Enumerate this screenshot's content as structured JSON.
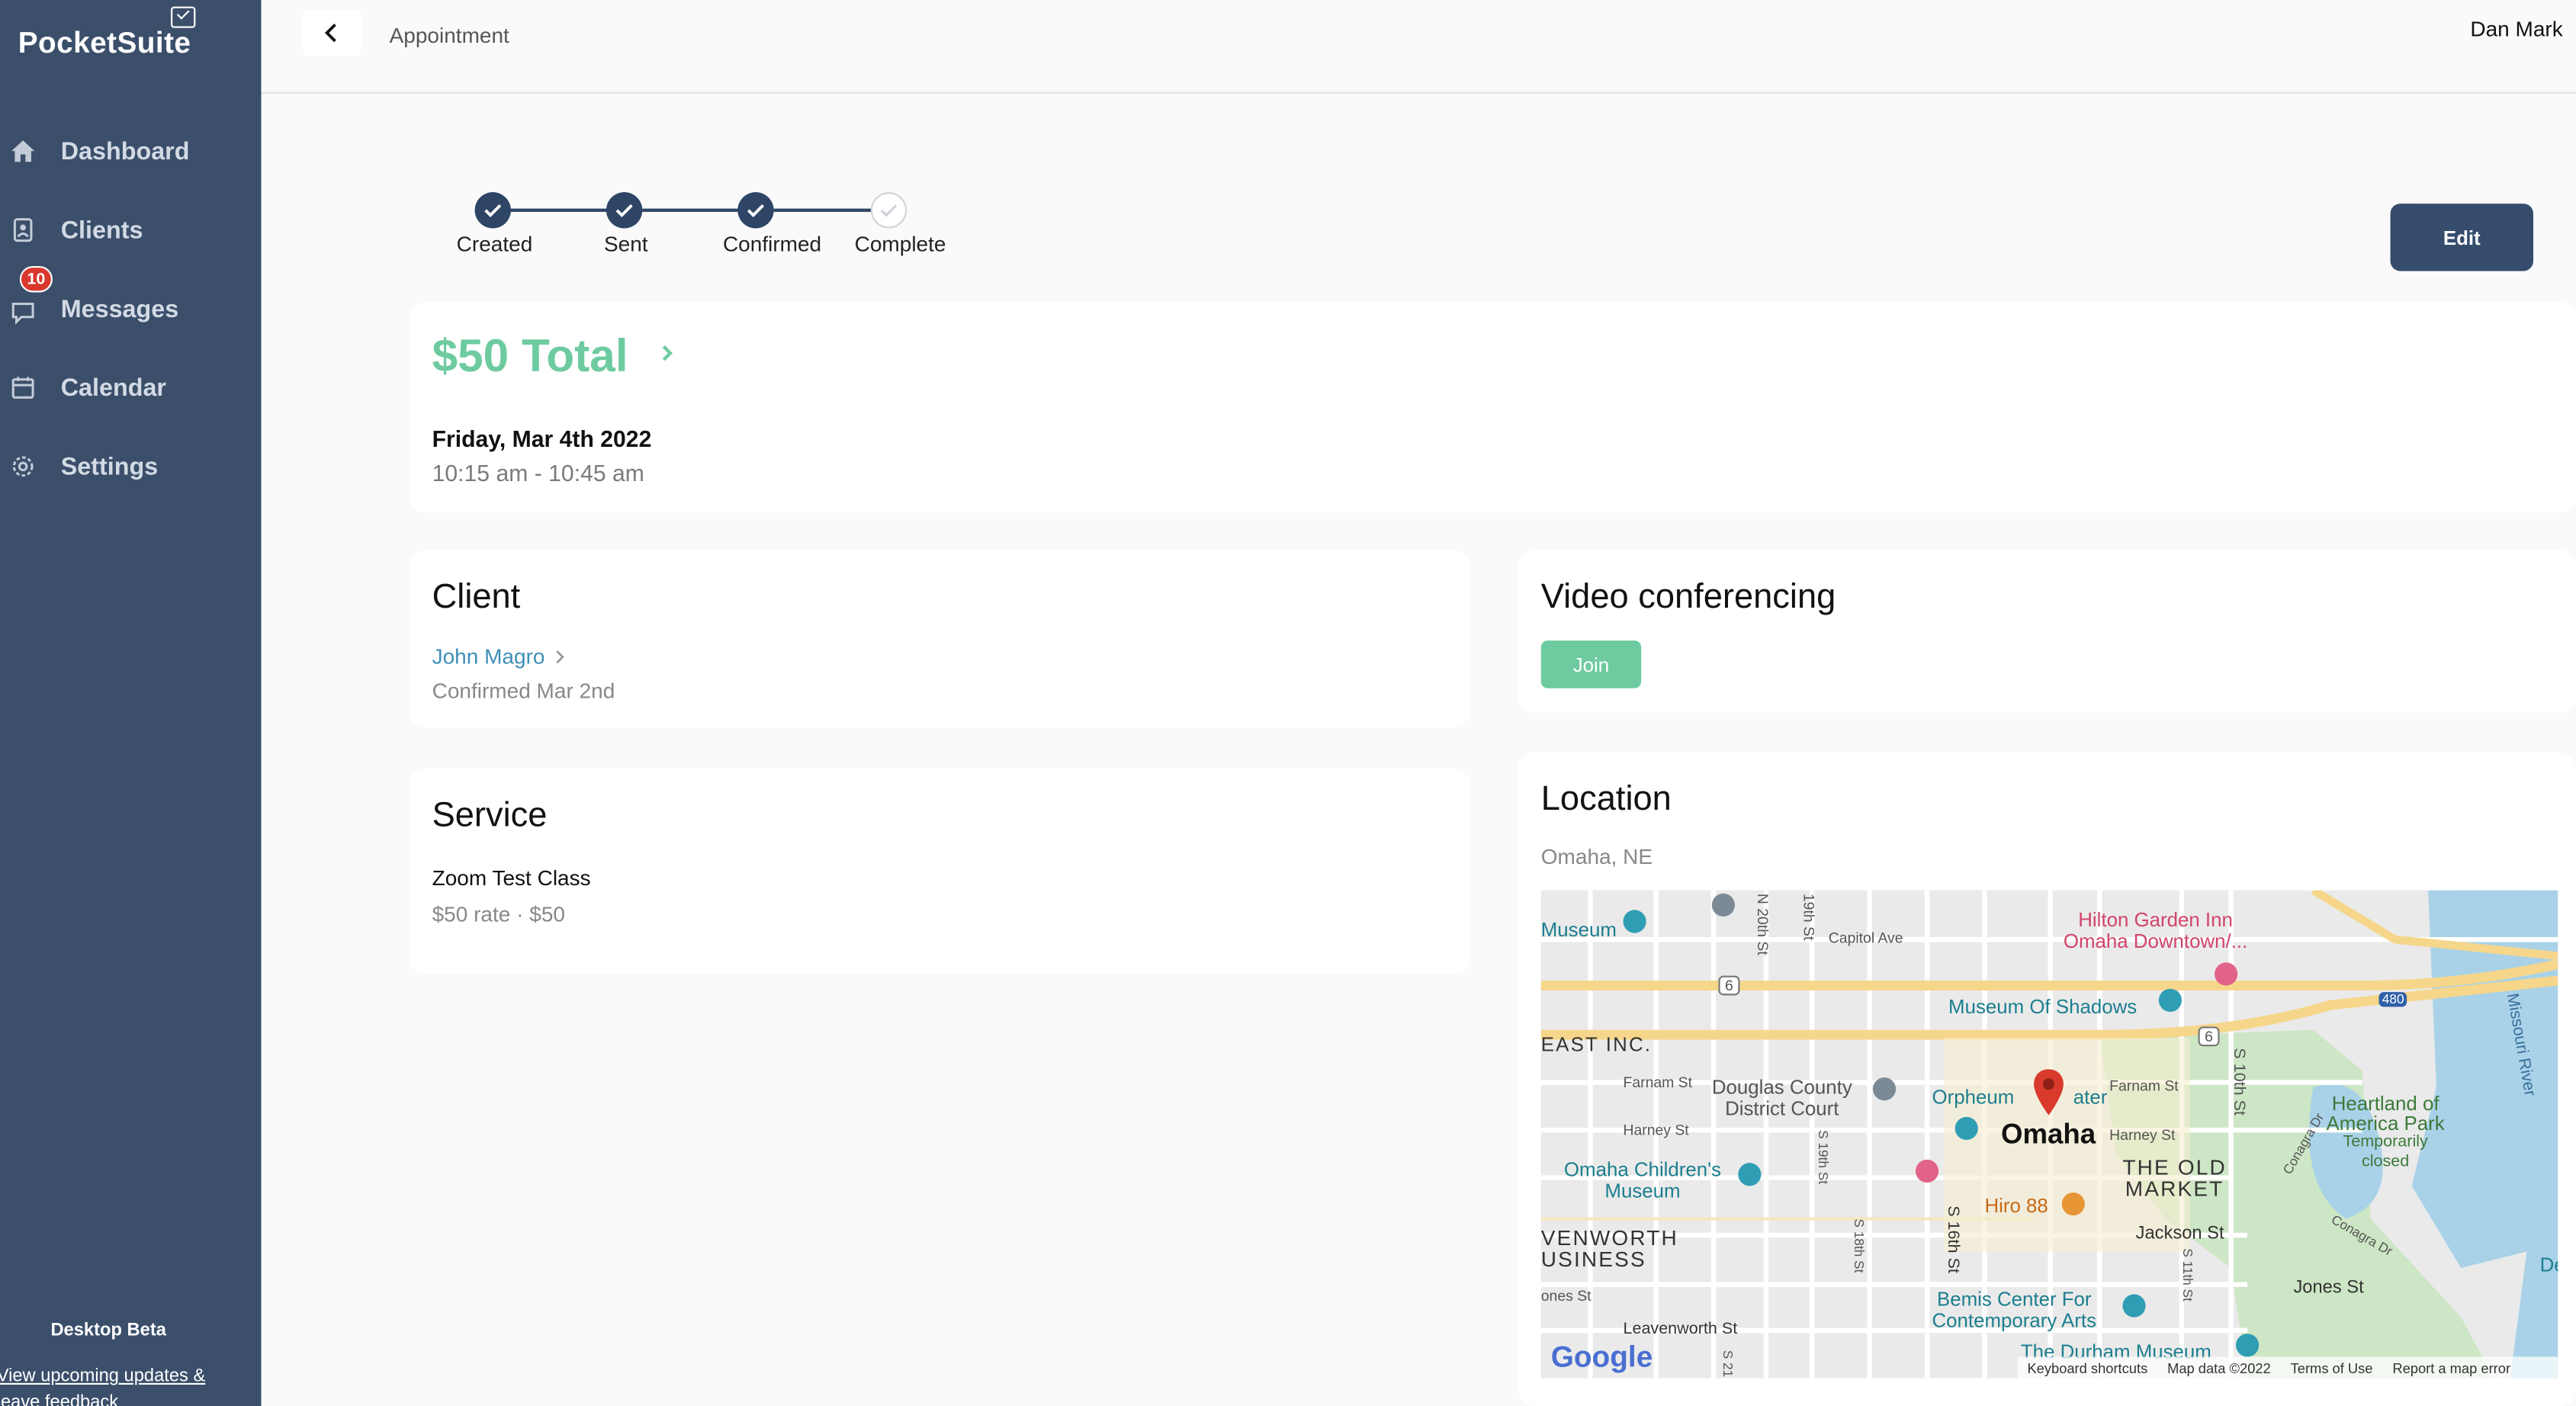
{
  "app": {
    "name": "PocketSuite"
  },
  "sidebar": {
    "items": [
      {
        "label": "Dashboard",
        "icon": "home-icon"
      },
      {
        "label": "Clients",
        "icon": "id-card-icon"
      },
      {
        "label": "Messages",
        "icon": "chat-icon",
        "badge": "10"
      },
      {
        "label": "Calendar",
        "icon": "calendar-icon"
      },
      {
        "label": "Settings",
        "icon": "gear-icon"
      }
    ],
    "beta_label": "Desktop Beta",
    "feedback_line1": "View upcoming updates &",
    "feedback_line2": "leave feedback"
  },
  "header": {
    "breadcrumb": "Appointment",
    "user_name": "Dan Mark"
  },
  "stepper": {
    "steps": [
      {
        "label": "Created",
        "done": true
      },
      {
        "label": "Sent",
        "done": true
      },
      {
        "label": "Confirmed",
        "done": true
      },
      {
        "label": "Complete",
        "done": false
      }
    ]
  },
  "actions": {
    "edit_label": "Edit"
  },
  "summary": {
    "total": "$50 Total",
    "date": "Friday, Mar 4th 2022",
    "time": "10:15 am - 10:45 am"
  },
  "client": {
    "title": "Client",
    "name": "John Magro",
    "status": "Confirmed Mar 2nd"
  },
  "service": {
    "title": "Service",
    "name": "Zoom Test Class",
    "rate": "$50 rate · $50"
  },
  "video": {
    "title": "Video conferencing",
    "join_label": "Join"
  },
  "location": {
    "title": "Location",
    "address": "Omaha, NE",
    "map": {
      "city": "Omaha",
      "places": {
        "museum_left": "Museum",
        "hilton_1": "Hilton Garden Inn",
        "hilton_2": "Omaha Downtown/...",
        "shadows": "Museum Of Shadows",
        "east_inc": "EAST INC.",
        "douglas_1": "Douglas County",
        "douglas_2": "District Court",
        "orpheum_a": "Orpheum",
        "orpheum_b": "ater",
        "heartland_1": "Heartland of",
        "heartland_2": "America Park",
        "heartland_3": "Temporarily",
        "heartland_4": "closed",
        "childrens_1": "Omaha Children's",
        "childrens_2": "Museum",
        "old_market_1": "THE OLD",
        "old_market_2": "MARKET",
        "hiro": "Hiro 88",
        "leavenworth_1": "VENWORTH",
        "leavenworth_2": "USINESS",
        "bemis_1": "Bemis Center For",
        "bemis_2": "Contemporary Arts",
        "durham": "The Durham Museum",
        "de": "De"
      },
      "streets": {
        "n20": "N 20th St",
        "s19": "19th St",
        "capitol": "Capitol Ave",
        "farnam_w": "Farnam St",
        "harney_w": "Harney St",
        "farnam_e": "Farnam St",
        "harney_e": "Harney St",
        "s10": "S 10th St",
        "jackson": "Jackson St",
        "jones": "Jones St",
        "jones_w": "ones St",
        "leavenworth": "Leavenworth St",
        "s16": "S 16th St",
        "s18": "S 18th St",
        "s19b": "S 19th St",
        "s11": "S 11th St",
        "s21": "S 21",
        "conagra_dr": "Conagra Dr",
        "conagra_dr2": "Conagra Dr",
        "missouri": "Missouri River",
        "hwy6": "6",
        "hwy6b": "6",
        "i480": "480"
      },
      "google": "Google",
      "attribution": {
        "shortcuts": "Keyboard shortcuts",
        "data": "Map data ©2022",
        "terms": "Terms of Use",
        "report": "Report a map error"
      }
    }
  },
  "colors": {
    "sidebar_bg": "#3b4f6b",
    "accent_green": "#6ecba0",
    "primary_dark": "#354c6c",
    "link_blue": "#3f8fb8",
    "badge_red": "#d9372d"
  }
}
